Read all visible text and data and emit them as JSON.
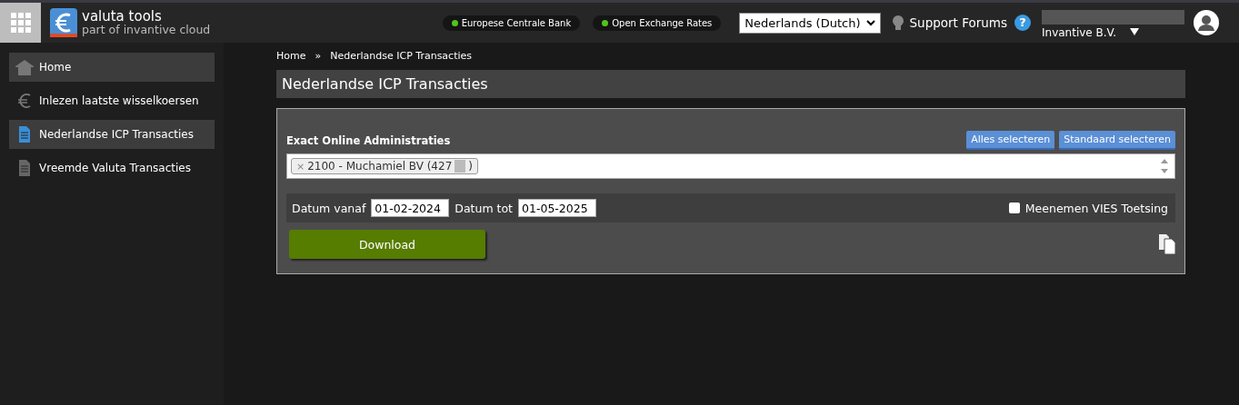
{
  "app": {
    "title": "valuta tools",
    "subtitle": "part of invantive cloud"
  },
  "sources": [
    {
      "label": "Europese Centrale Bank",
      "color": "#52c41a"
    },
    {
      "label": "Open Exchange Rates",
      "color": "#52c41a"
    }
  ],
  "language": {
    "value": "Nederlands (Dutch)"
  },
  "support": {
    "label": "Support Forums",
    "help": "?"
  },
  "account": {
    "company": "Invantive B.V."
  },
  "sidebar": {
    "items": [
      {
        "label": "Home",
        "kind": "home",
        "selected": true
      },
      {
        "label": "Inlezen laatste wisselkoersen",
        "kind": "euro",
        "selected": false
      },
      {
        "label": "Nederlandse ICP Transacties",
        "kind": "doc",
        "selected": true
      },
      {
        "label": "Vreemde Valuta Transacties",
        "kind": "doc",
        "selected": false
      }
    ]
  },
  "breadcrumb": [
    {
      "label": "Home"
    },
    {
      "label": "»"
    },
    {
      "label": "Nederlandse ICP Transacties"
    }
  ],
  "page_title": "Nederlandse ICP Transacties",
  "form": {
    "admin_label": "Exact Online Administraties",
    "buttons": [
      "Alles selecteren",
      "Standaard selecteren"
    ],
    "tags": [
      {
        "remove": "×",
        "label": "2100 - Muchamiel BV (427",
        "suffix": ")"
      }
    ],
    "date_from": {
      "label": "Datum vanaf",
      "value": "01-02-2024"
    },
    "date_to": {
      "label": "Datum tot",
      "value": "01-05-2025"
    },
    "vies": {
      "label": "Meenemen VIES Toetsing",
      "checked": false
    },
    "download": "Download"
  }
}
